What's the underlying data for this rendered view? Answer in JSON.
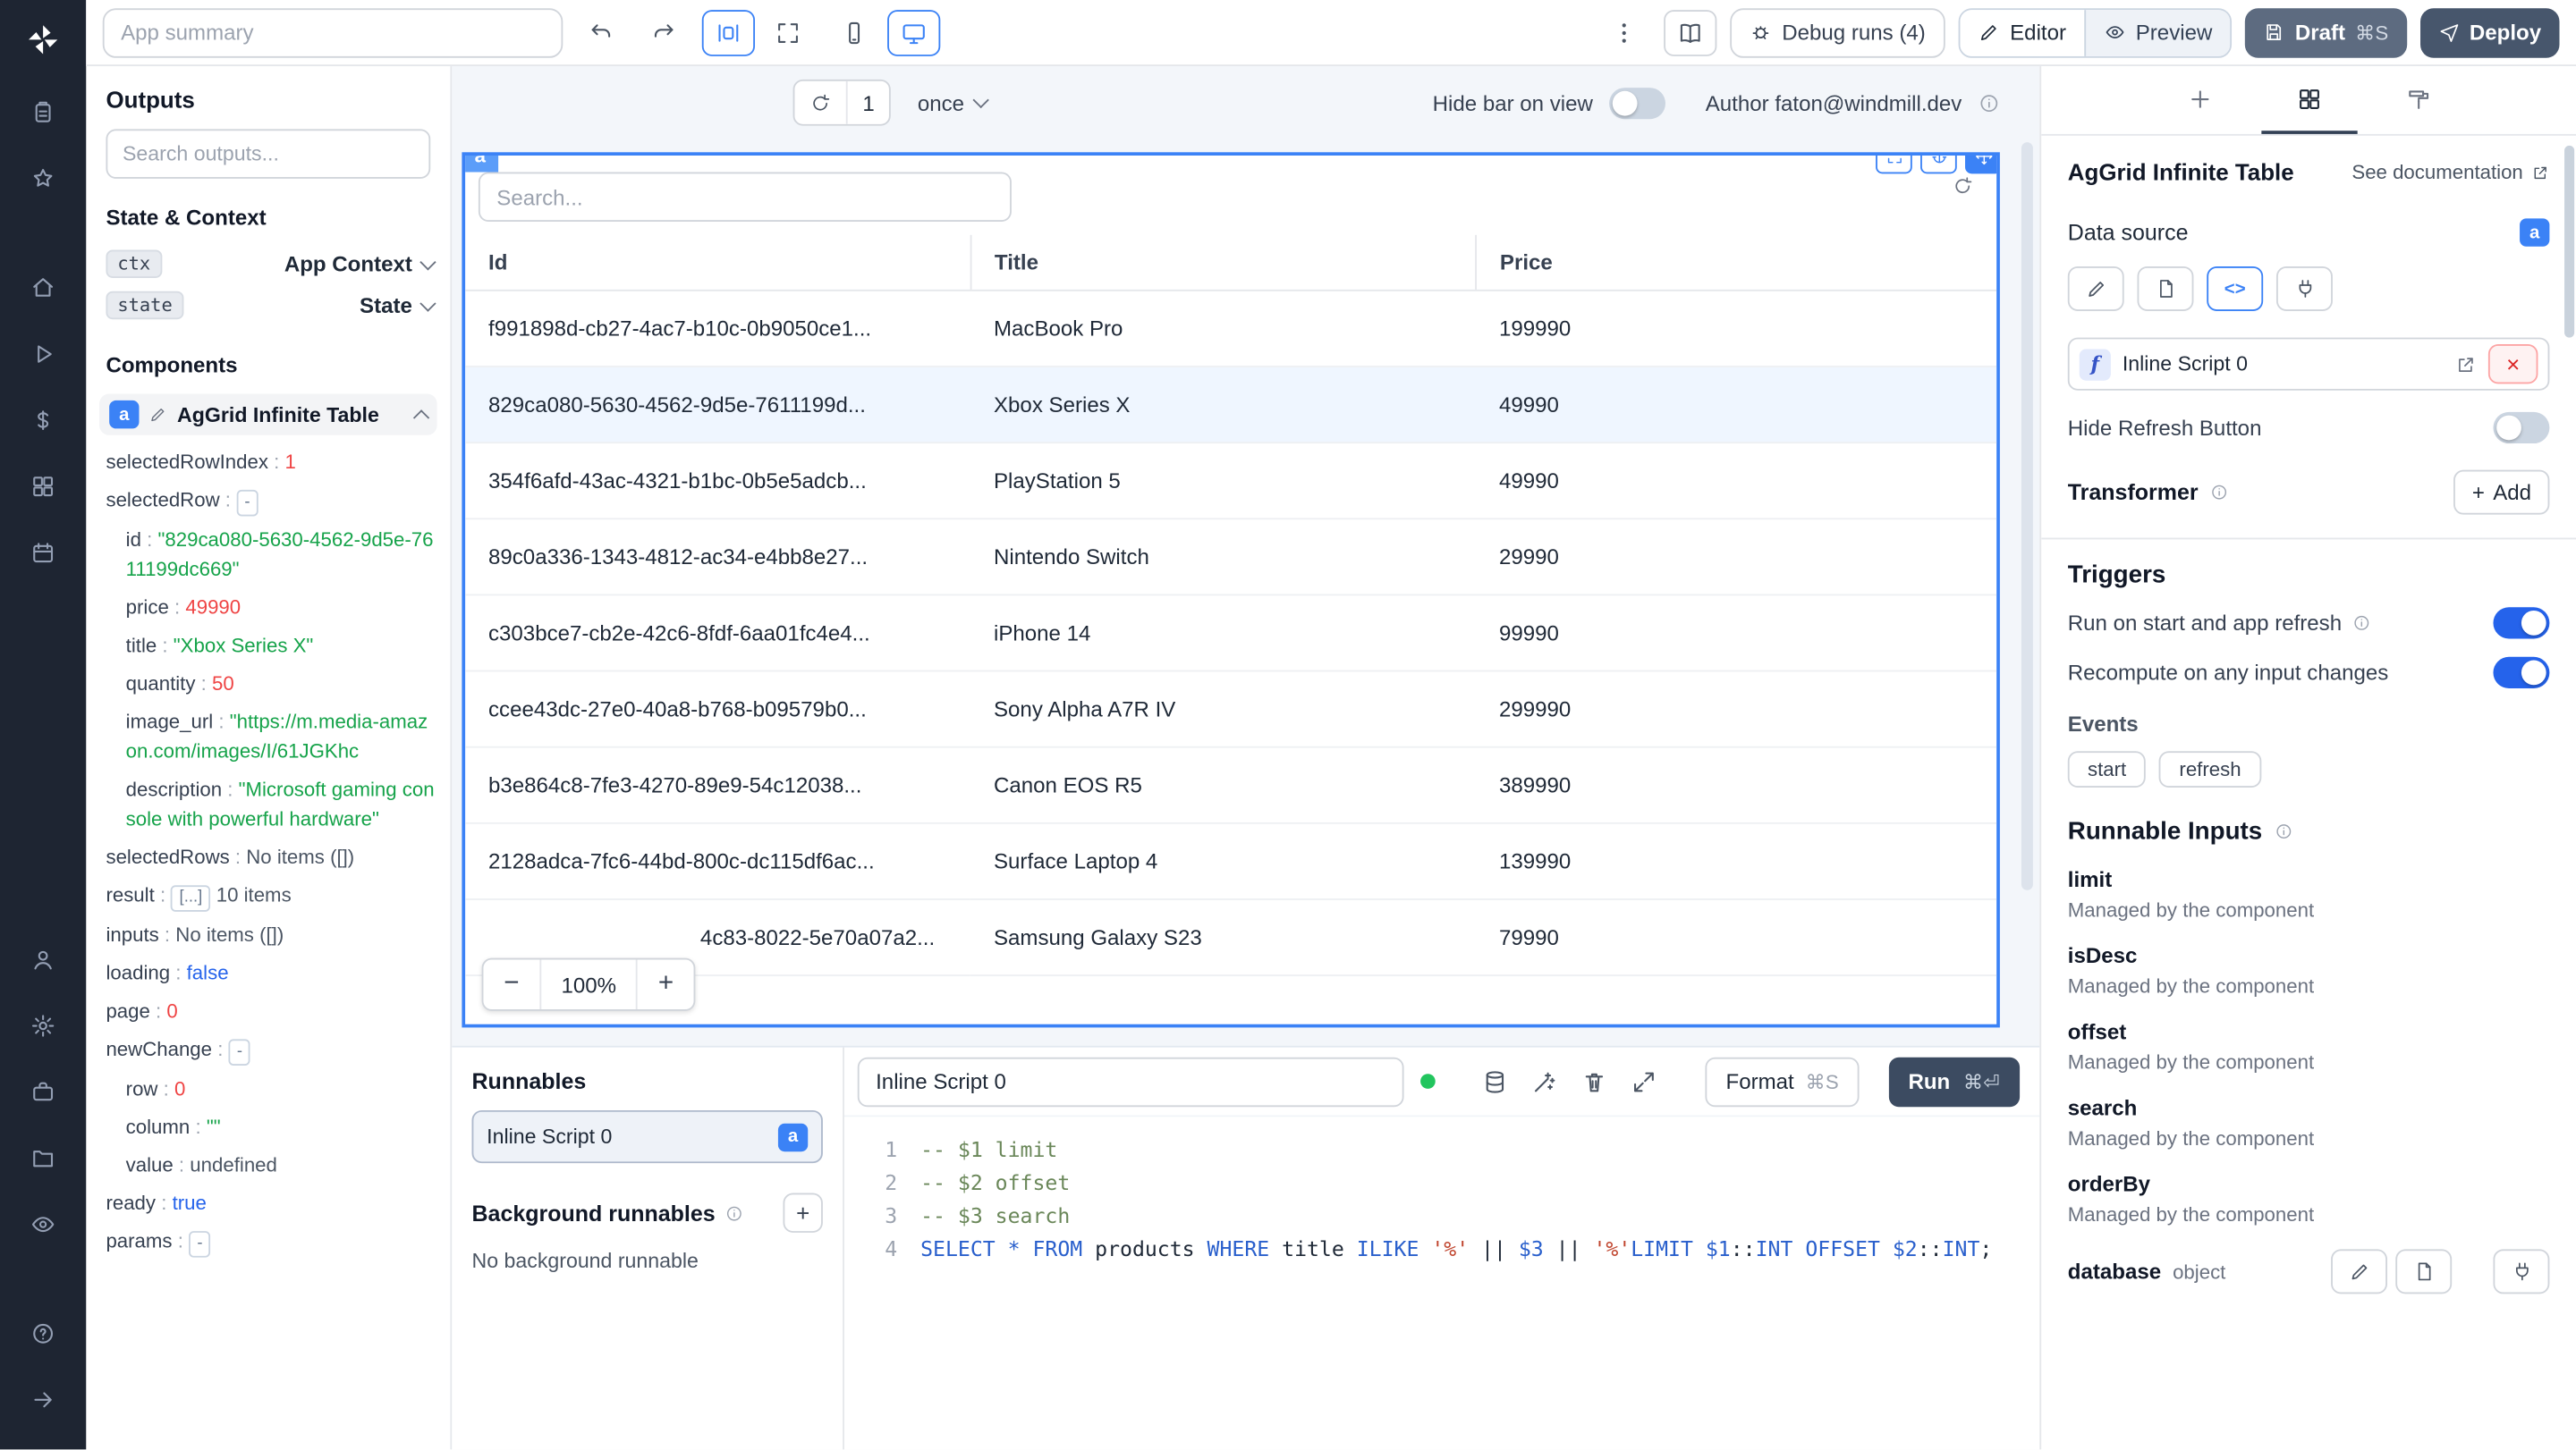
{
  "topbar": {
    "app_summary_placeholder": "App summary",
    "debug_runs": "Debug runs (4)",
    "editor": "Editor",
    "preview": "Preview",
    "draft": "Draft",
    "draft_shortcut": "⌘S",
    "deploy": "Deploy"
  },
  "outputs": {
    "title": "Outputs",
    "search_placeholder": "Search outputs...",
    "state_context": "State & Context",
    "ctx_badge": "ctx",
    "ctx_label": "App Context",
    "state_badge": "state",
    "state_label": "State",
    "components": "Components",
    "component_badge": "a",
    "component_name": "AgGrid Infinite Table",
    "tree": [
      {
        "key": "selectedRowIndex",
        "type": "number",
        "value": "1",
        "indent": 0
      },
      {
        "key": "selectedRow",
        "type": "badge",
        "value": "-",
        "indent": 0
      },
      {
        "key": "id",
        "type": "string",
        "value": "\"829ca080-5630-4562-9d5e-7611199dc669\"",
        "indent": 1
      },
      {
        "key": "price",
        "type": "number",
        "value": "49990",
        "indent": 1
      },
      {
        "key": "title",
        "type": "string",
        "value": "\"Xbox Series X\"",
        "indent": 1
      },
      {
        "key": "quantity",
        "type": "number",
        "value": "50",
        "indent": 1
      },
      {
        "key": "image_url",
        "type": "string",
        "value": "\"https://m.media-amazon.com/images/I/61JGKhc",
        "indent": 1
      },
      {
        "key": "description",
        "type": "string",
        "value": "\"Microsoft gaming console with powerful hardware\"",
        "indent": 1
      },
      {
        "key": "selectedRows",
        "type": "muted",
        "value": "No items ([])",
        "indent": 0
      },
      {
        "key": "result",
        "type": "collection",
        "badge": "[...]",
        "value": "10 items",
        "indent": 0
      },
      {
        "key": "inputs",
        "type": "muted",
        "value": "No items ([])",
        "indent": 0
      },
      {
        "key": "loading",
        "type": "boolean",
        "value": "false",
        "indent": 0
      },
      {
        "key": "page",
        "type": "number",
        "value": "0",
        "indent": 0
      },
      {
        "key": "newChange",
        "type": "badge",
        "value": "-",
        "indent": 0
      },
      {
        "key": "row",
        "type": "number",
        "value": "0",
        "indent": 1
      },
      {
        "key": "column",
        "type": "string",
        "value": "\"\"",
        "indent": 1
      },
      {
        "key": "value",
        "type": "muted",
        "value": "undefined",
        "indent": 1
      },
      {
        "key": "ready",
        "type": "boolean",
        "value": "true",
        "indent": 0
      },
      {
        "key": "params",
        "type": "badge",
        "value": "-",
        "indent": 0
      }
    ]
  },
  "canvas": {
    "refresh_count": "1",
    "frequency": "once",
    "hide_bar": "Hide bar on view",
    "author": "Author faton@windmill.dev",
    "component_tag": "a",
    "zoom": "100%",
    "search_placeholder": "Search...",
    "table": {
      "columns": [
        "Id",
        "Title",
        "Price"
      ],
      "selected_index": 1,
      "rows": [
        [
          "f991898d-cb27-4ac7-b10c-0b9050ce1...",
          "MacBook Pro",
          "199990"
        ],
        [
          "829ca080-5630-4562-9d5e-7611199d...",
          "Xbox Series X",
          "49990"
        ],
        [
          "354f6afd-43ac-4321-b1bc-0b5e5adcb...",
          "PlayStation 5",
          "49990"
        ],
        [
          "89c0a336-1343-4812-ac34-e4bb8e27...",
          "Nintendo Switch",
          "29990"
        ],
        [
          "c303bce7-cb2e-42c6-8fdf-6aa01fc4e4...",
          "iPhone 14",
          "99990"
        ],
        [
          "ccee43dc-27e0-40a8-b768-b09579b0...",
          "Sony Alpha A7R IV",
          "299990"
        ],
        [
          "b3e864c8-7fe3-4270-89e9-54c12038...",
          "Canon EOS R5",
          "389990"
        ],
        [
          "2128adca-7fc6-44bd-800c-dc115df6ac...",
          "Surface Laptop 4",
          "139990"
        ],
        [
          "4c83-8022-5e70a07a2...",
          "Samsung Galaxy S23",
          "79990"
        ]
      ]
    }
  },
  "runnables": {
    "title": "Runnables",
    "items": [
      {
        "name": "Inline Script 0",
        "badge": "a"
      }
    ],
    "background_title": "Background runnables",
    "background_empty": "No background runnable"
  },
  "editor": {
    "script_name": "Inline Script 0",
    "format": "Format",
    "format_shortcut": "⌘S",
    "run": "Run",
    "run_shortcut": "⌘⏎",
    "code": [
      {
        "num": "1",
        "tokens": [
          {
            "c": "comment",
            "t": "-- $1 limit"
          }
        ]
      },
      {
        "num": "2",
        "tokens": [
          {
            "c": "comment",
            "t": "-- $2 offset"
          }
        ]
      },
      {
        "num": "3",
        "tokens": [
          {
            "c": "comment",
            "t": "-- $3 search"
          }
        ]
      },
      {
        "num": "4",
        "tokens": [
          {
            "c": "kw",
            "t": "SELECT"
          },
          {
            "c": "plain",
            "t": " "
          },
          {
            "c": "kw",
            "t": "*"
          },
          {
            "c": "plain",
            "t": " "
          },
          {
            "c": "kw",
            "t": "FROM"
          },
          {
            "c": "plain",
            "t": " products "
          },
          {
            "c": "kw",
            "t": "WHERE"
          },
          {
            "c": "plain",
            "t": " title "
          },
          {
            "c": "kw",
            "t": "ILIKE"
          },
          {
            "c": "plain",
            "t": " "
          },
          {
            "c": "str",
            "t": "'%'"
          },
          {
            "c": "plain",
            "t": " || "
          },
          {
            "c": "var",
            "t": "$3"
          },
          {
            "c": "plain",
            "t": " || "
          },
          {
            "c": "str",
            "t": "'%'"
          },
          {
            "c": "kw",
            "t": "LIMIT"
          },
          {
            "c": "plain",
            "t": " "
          },
          {
            "c": "var",
            "t": "$1"
          },
          {
            "c": "plain",
            "t": "::"
          },
          {
            "c": "kw",
            "t": "INT"
          },
          {
            "c": "plain",
            "t": " "
          },
          {
            "c": "kw",
            "t": "OFFSET"
          },
          {
            "c": "plain",
            "t": " "
          },
          {
            "c": "var",
            "t": "$2"
          },
          {
            "c": "plain",
            "t": "::"
          },
          {
            "c": "kw",
            "t": "INT"
          },
          {
            "c": "plain",
            "t": ";"
          }
        ]
      }
    ]
  },
  "right": {
    "title": "AgGrid Infinite Table",
    "see_documentation": "See documentation",
    "data_source": "Data source",
    "data_source_badge": "a",
    "code_mode_label": "<>",
    "script_name": "Inline Script 0",
    "hide_refresh": "Hide Refresh Button",
    "transformer": "Transformer",
    "add": "Add",
    "triggers": "Triggers",
    "trigger_rows": [
      {
        "label": "Run on start and app refresh",
        "info": true,
        "on": true
      },
      {
        "label": "Recompute on any input changes",
        "info": false,
        "on": true
      }
    ],
    "events": "Events",
    "event_chips": [
      "start",
      "refresh"
    ],
    "runnable_inputs": "Runnable Inputs",
    "inputs": [
      {
        "name": "limit",
        "desc": "Managed by the component"
      },
      {
        "name": "isDesc",
        "desc": "Managed by the component"
      },
      {
        "name": "offset",
        "desc": "Managed by the component"
      },
      {
        "name": "search",
        "desc": "Managed by the component"
      },
      {
        "name": "orderBy",
        "desc": "Managed by the component"
      }
    ],
    "database": {
      "name": "database",
      "type": "object"
    }
  }
}
